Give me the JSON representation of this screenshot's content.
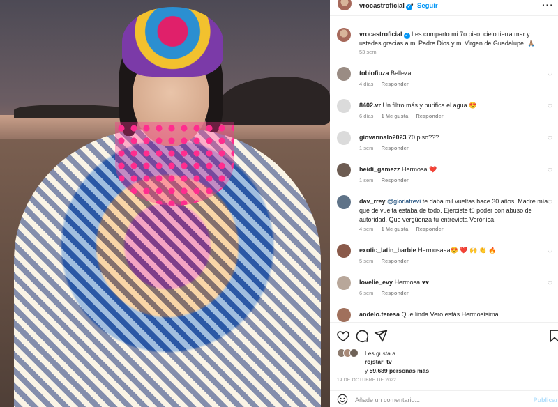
{
  "post": {
    "username": "vrocastroficial",
    "follow_label": "Seguir",
    "more_icon": "more-horizontal-icon"
  },
  "caption": {
    "username": "vrocastroficial",
    "text": "Les comparto mi 7o piso, cielo tierra mar y ustedes gracias a mi Padre Dios y mi Virgen de Guadalupe. 🙏🏽",
    "time": "53 sem"
  },
  "comments": [
    {
      "user": "tobiofiuza",
      "text": "Belleza",
      "time": "4 días",
      "likes": "",
      "reply": "Responder",
      "avatar_color": "#9a8c84"
    },
    {
      "user": "8402.vr",
      "text": "Un filtro más y purifica el agua 😍",
      "time": "6 días",
      "likes": "1 Me gusta",
      "reply": "Responder",
      "avatar_color": "#dbdbdb"
    },
    {
      "user": "giovannalo2023",
      "text": "70 piso???",
      "time": "1 sem",
      "likes": "",
      "reply": "Responder",
      "avatar_color": "#dbdbdb"
    },
    {
      "user": "heidi_gamezz",
      "text": "Hermosa ❤️",
      "time": "1 sem",
      "likes": "",
      "reply": "Responder",
      "avatar_color": "#6d5c52"
    },
    {
      "user": "dav_rrey",
      "mention": "@gloriatrevi",
      "text": " te daba mil vueltas hace 30 años. Madre mía qué de vuelta estaba de todo. Ejerciste tú poder con abuso de autoridad. Que vergüenza tu entrevista Verónica.",
      "time": "4 sem",
      "likes": "1 Me gusta",
      "reply": "Responder",
      "avatar_color": "#5f7388"
    },
    {
      "user": "exotic_latin_barbie",
      "text": "Hermosaaa😍 ❤️ 🙌 👏 🔥",
      "time": "5 sem",
      "likes": "",
      "reply": "Responder",
      "avatar_color": "#8a5a4a"
    },
    {
      "user": "lovelie_evy",
      "text": "Hermosa ♥♥",
      "time": "6 sem",
      "likes": "",
      "reply": "Responder",
      "avatar_color": "#b8a79a"
    },
    {
      "user": "andelo.teresa",
      "text": "Que linda Vero estás Hermosísima",
      "time": "",
      "likes": "",
      "reply": "",
      "avatar_color": "#a0705c"
    }
  ],
  "likes": {
    "prefix": "Les gusta a",
    "user": "rojstar_tv",
    "and": "y",
    "count": "59.689 personas más"
  },
  "date": "19 DE OCTUBRE DE 2022",
  "comment_box": {
    "placeholder": "Añade un comentario...",
    "post_label": "Publicar"
  },
  "colors": {
    "accent": "#0095f6",
    "muted": "#8e8e8e",
    "text": "#262626"
  }
}
